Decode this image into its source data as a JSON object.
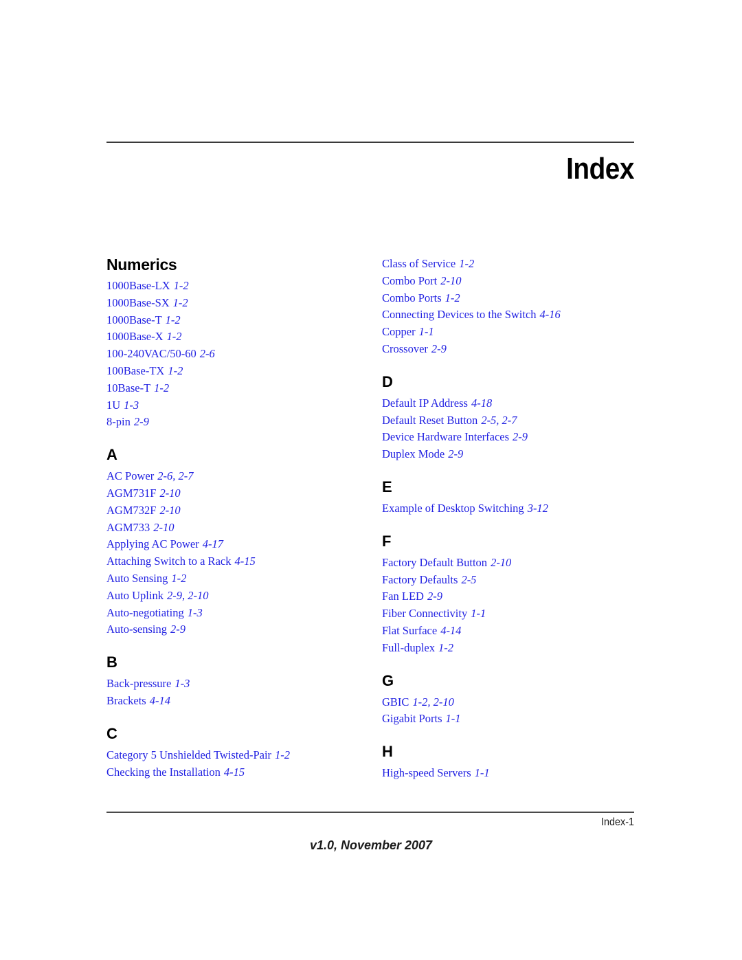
{
  "header": {
    "title": "Index"
  },
  "footer": {
    "page_label": "Index-1",
    "version": "v1.0, November 2007"
  },
  "columns": {
    "left": [
      {
        "heading": "Numerics",
        "heading_style": "word",
        "entries": [
          {
            "term": "1000Base-LX",
            "locs": "1-2"
          },
          {
            "term": "1000Base-SX",
            "locs": "1-2"
          },
          {
            "term": "1000Base-T",
            "locs": "1-2"
          },
          {
            "term": "1000Base-X",
            "locs": "1-2"
          },
          {
            "term": "100-240VAC/50-60",
            "locs": "2-6"
          },
          {
            "term": "100Base-TX",
            "locs": "1-2"
          },
          {
            "term": "10Base-T",
            "locs": "1-2"
          },
          {
            "term": "1U",
            "locs": "1-3"
          },
          {
            "term": "8-pin",
            "locs": "2-9"
          }
        ]
      },
      {
        "heading": "A",
        "heading_style": "letter",
        "entries": [
          {
            "term": "AC Power",
            "locs": "2-6, 2-7"
          },
          {
            "term": "AGM731F",
            "locs": "2-10"
          },
          {
            "term": "AGM732F",
            "locs": "2-10"
          },
          {
            "term": "AGM733",
            "locs": "2-10"
          },
          {
            "term": "Applying AC Power",
            "locs": "4-17"
          },
          {
            "term": "Attaching Switch to a Rack",
            "locs": "4-15"
          },
          {
            "term": "Auto Sensing",
            "locs": "1-2"
          },
          {
            "term": "Auto Uplink",
            "locs": "2-9, 2-10"
          },
          {
            "term": "Auto-negotiating",
            "locs": "1-3"
          },
          {
            "term": "Auto-sensing",
            "locs": "2-9"
          }
        ]
      },
      {
        "heading": "B",
        "heading_style": "letter",
        "entries": [
          {
            "term": "Back-pressure",
            "locs": "1-3"
          },
          {
            "term": "Brackets",
            "locs": "4-14"
          }
        ]
      },
      {
        "heading": "C",
        "heading_style": "letter",
        "entries": [
          {
            "term": "Category 5 Unshielded Twisted-Pair",
            "locs": "1-2"
          },
          {
            "term": "Checking the Installation",
            "locs": "4-15"
          }
        ]
      }
    ],
    "right": [
      {
        "heading": "",
        "heading_style": "none",
        "entries": [
          {
            "term": "Class of Service",
            "locs": "1-2"
          },
          {
            "term": "Combo Port",
            "locs": "2-10"
          },
          {
            "term": "Combo Ports",
            "locs": "1-2"
          },
          {
            "term": "Connecting Devices to the Switch",
            "locs": "4-16"
          },
          {
            "term": "Copper",
            "locs": "1-1"
          },
          {
            "term": "Crossover",
            "locs": "2-9"
          }
        ]
      },
      {
        "heading": "D",
        "heading_style": "letter",
        "entries": [
          {
            "term": "Default IP Address",
            "locs": "4-18"
          },
          {
            "term": "Default Reset Button",
            "locs": "2-5, 2-7"
          },
          {
            "term": "Device Hardware Interfaces",
            "locs": "2-9"
          },
          {
            "term": "Duplex Mode",
            "locs": "2-9"
          }
        ]
      },
      {
        "heading": "E",
        "heading_style": "letter",
        "entries": [
          {
            "term": "Example of Desktop Switching",
            "locs": "3-12"
          }
        ]
      },
      {
        "heading": "F",
        "heading_style": "letter",
        "entries": [
          {
            "term": "Factory Default Button",
            "locs": "2-10"
          },
          {
            "term": "Factory Defaults",
            "locs": "2-5"
          },
          {
            "term": "Fan LED",
            "locs": "2-9"
          },
          {
            "term": "Fiber Connectivity",
            "locs": "1-1"
          },
          {
            "term": "Flat Surface",
            "locs": "4-14"
          },
          {
            "term": "Full-duplex",
            "locs": "1-2"
          }
        ]
      },
      {
        "heading": "G",
        "heading_style": "letter",
        "entries": [
          {
            "term": "GBIC",
            "locs": "1-2, 2-10"
          },
          {
            "term": "Gigabit Ports",
            "locs": "1-1"
          }
        ]
      },
      {
        "heading": "H",
        "heading_style": "letter",
        "entries": [
          {
            "term": "High-speed Servers",
            "locs": "1-1"
          }
        ]
      }
    ]
  },
  "colors": {
    "entry_link": "#2222e2",
    "heading": "#000000",
    "rule": "#3a3a3a"
  }
}
